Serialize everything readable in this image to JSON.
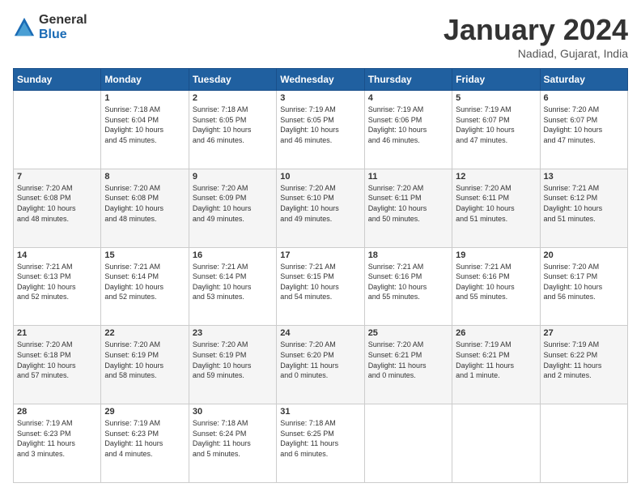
{
  "header": {
    "logo_general": "General",
    "logo_blue": "Blue",
    "title": "January 2024",
    "location": "Nadiad, Gujarat, India"
  },
  "days_of_week": [
    "Sunday",
    "Monday",
    "Tuesday",
    "Wednesday",
    "Thursday",
    "Friday",
    "Saturday"
  ],
  "weeks": [
    [
      {
        "day": "",
        "info": ""
      },
      {
        "day": "1",
        "info": "Sunrise: 7:18 AM\nSunset: 6:04 PM\nDaylight: 10 hours\nand 45 minutes."
      },
      {
        "day": "2",
        "info": "Sunrise: 7:18 AM\nSunset: 6:05 PM\nDaylight: 10 hours\nand 46 minutes."
      },
      {
        "day": "3",
        "info": "Sunrise: 7:19 AM\nSunset: 6:05 PM\nDaylight: 10 hours\nand 46 minutes."
      },
      {
        "day": "4",
        "info": "Sunrise: 7:19 AM\nSunset: 6:06 PM\nDaylight: 10 hours\nand 46 minutes."
      },
      {
        "day": "5",
        "info": "Sunrise: 7:19 AM\nSunset: 6:07 PM\nDaylight: 10 hours\nand 47 minutes."
      },
      {
        "day": "6",
        "info": "Sunrise: 7:20 AM\nSunset: 6:07 PM\nDaylight: 10 hours\nand 47 minutes."
      }
    ],
    [
      {
        "day": "7",
        "info": "Sunrise: 7:20 AM\nSunset: 6:08 PM\nDaylight: 10 hours\nand 48 minutes."
      },
      {
        "day": "8",
        "info": "Sunrise: 7:20 AM\nSunset: 6:08 PM\nDaylight: 10 hours\nand 48 minutes."
      },
      {
        "day": "9",
        "info": "Sunrise: 7:20 AM\nSunset: 6:09 PM\nDaylight: 10 hours\nand 49 minutes."
      },
      {
        "day": "10",
        "info": "Sunrise: 7:20 AM\nSunset: 6:10 PM\nDaylight: 10 hours\nand 49 minutes."
      },
      {
        "day": "11",
        "info": "Sunrise: 7:20 AM\nSunset: 6:11 PM\nDaylight: 10 hours\nand 50 minutes."
      },
      {
        "day": "12",
        "info": "Sunrise: 7:20 AM\nSunset: 6:11 PM\nDaylight: 10 hours\nand 51 minutes."
      },
      {
        "day": "13",
        "info": "Sunrise: 7:21 AM\nSunset: 6:12 PM\nDaylight: 10 hours\nand 51 minutes."
      }
    ],
    [
      {
        "day": "14",
        "info": "Sunrise: 7:21 AM\nSunset: 6:13 PM\nDaylight: 10 hours\nand 52 minutes."
      },
      {
        "day": "15",
        "info": "Sunrise: 7:21 AM\nSunset: 6:14 PM\nDaylight: 10 hours\nand 52 minutes."
      },
      {
        "day": "16",
        "info": "Sunrise: 7:21 AM\nSunset: 6:14 PM\nDaylight: 10 hours\nand 53 minutes."
      },
      {
        "day": "17",
        "info": "Sunrise: 7:21 AM\nSunset: 6:15 PM\nDaylight: 10 hours\nand 54 minutes."
      },
      {
        "day": "18",
        "info": "Sunrise: 7:21 AM\nSunset: 6:16 PM\nDaylight: 10 hours\nand 55 minutes."
      },
      {
        "day": "19",
        "info": "Sunrise: 7:21 AM\nSunset: 6:16 PM\nDaylight: 10 hours\nand 55 minutes."
      },
      {
        "day": "20",
        "info": "Sunrise: 7:20 AM\nSunset: 6:17 PM\nDaylight: 10 hours\nand 56 minutes."
      }
    ],
    [
      {
        "day": "21",
        "info": "Sunrise: 7:20 AM\nSunset: 6:18 PM\nDaylight: 10 hours\nand 57 minutes."
      },
      {
        "day": "22",
        "info": "Sunrise: 7:20 AM\nSunset: 6:19 PM\nDaylight: 10 hours\nand 58 minutes."
      },
      {
        "day": "23",
        "info": "Sunrise: 7:20 AM\nSunset: 6:19 PM\nDaylight: 10 hours\nand 59 minutes."
      },
      {
        "day": "24",
        "info": "Sunrise: 7:20 AM\nSunset: 6:20 PM\nDaylight: 11 hours\nand 0 minutes."
      },
      {
        "day": "25",
        "info": "Sunrise: 7:20 AM\nSunset: 6:21 PM\nDaylight: 11 hours\nand 0 minutes."
      },
      {
        "day": "26",
        "info": "Sunrise: 7:19 AM\nSunset: 6:21 PM\nDaylight: 11 hours\nand 1 minute."
      },
      {
        "day": "27",
        "info": "Sunrise: 7:19 AM\nSunset: 6:22 PM\nDaylight: 11 hours\nand 2 minutes."
      }
    ],
    [
      {
        "day": "28",
        "info": "Sunrise: 7:19 AM\nSunset: 6:23 PM\nDaylight: 11 hours\nand 3 minutes."
      },
      {
        "day": "29",
        "info": "Sunrise: 7:19 AM\nSunset: 6:23 PM\nDaylight: 11 hours\nand 4 minutes."
      },
      {
        "day": "30",
        "info": "Sunrise: 7:18 AM\nSunset: 6:24 PM\nDaylight: 11 hours\nand 5 minutes."
      },
      {
        "day": "31",
        "info": "Sunrise: 7:18 AM\nSunset: 6:25 PM\nDaylight: 11 hours\nand 6 minutes."
      },
      {
        "day": "",
        "info": ""
      },
      {
        "day": "",
        "info": ""
      },
      {
        "day": "",
        "info": ""
      }
    ]
  ]
}
